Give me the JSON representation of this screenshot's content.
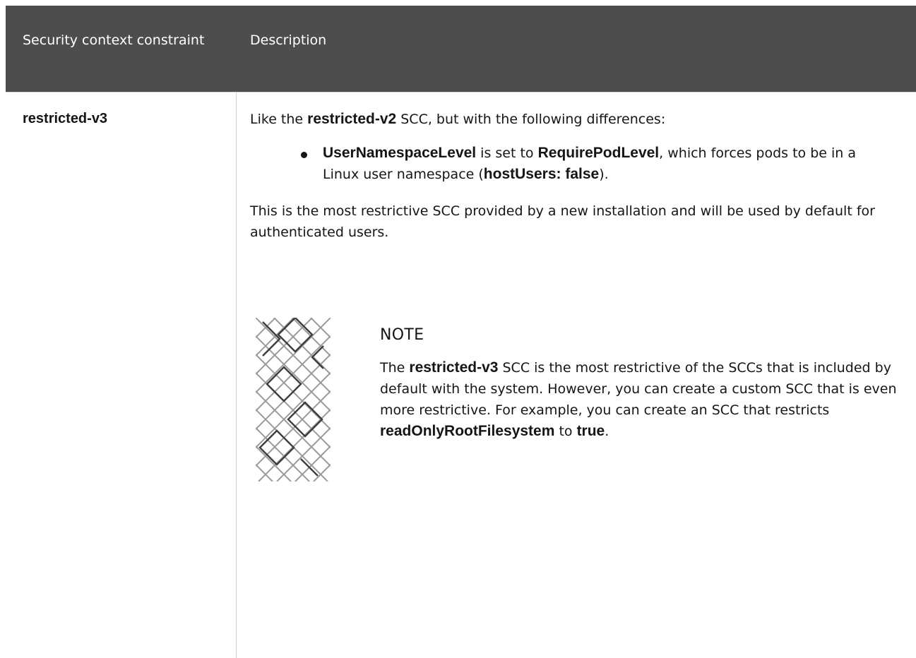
{
  "table": {
    "headers": {
      "scc": "Security context constraint",
      "description": "Description"
    },
    "row": {
      "name": "restricted-v3",
      "intro_pre": "Like the ",
      "intro_bold": "restricted-v2",
      "intro_post": " SCC, but with the following differences:",
      "bullet": {
        "b1": "UserNamespaceLevel",
        "t1": " is set to ",
        "b2": "RequirePodLevel",
        "t2": ", which forces pods to be in a Linux user namespace (",
        "b3": "hostUsers: false",
        "t3": ")."
      },
      "summary": "This is the most restrictive SCC provided by a new installation and will be used by default for authenticated users."
    }
  },
  "note": {
    "icon": "note-pattern-icon",
    "title": "NOTE",
    "t1": "The ",
    "b1": "restricted-v3",
    "t2": " SCC is the most restrictive of the SCCs that is included by default with the system. However, you can create a custom SCC that is even more restrictive. For example, you can create an SCC that restricts ",
    "b2": "readOnlyRootFilesystem",
    "t3": " to ",
    "b3": "true",
    "t4": "."
  },
  "colors": {
    "header_bg": "#4d4d4d",
    "header_text": "#ffffff",
    "text": "#151515",
    "divider": "#d2d2d2"
  }
}
